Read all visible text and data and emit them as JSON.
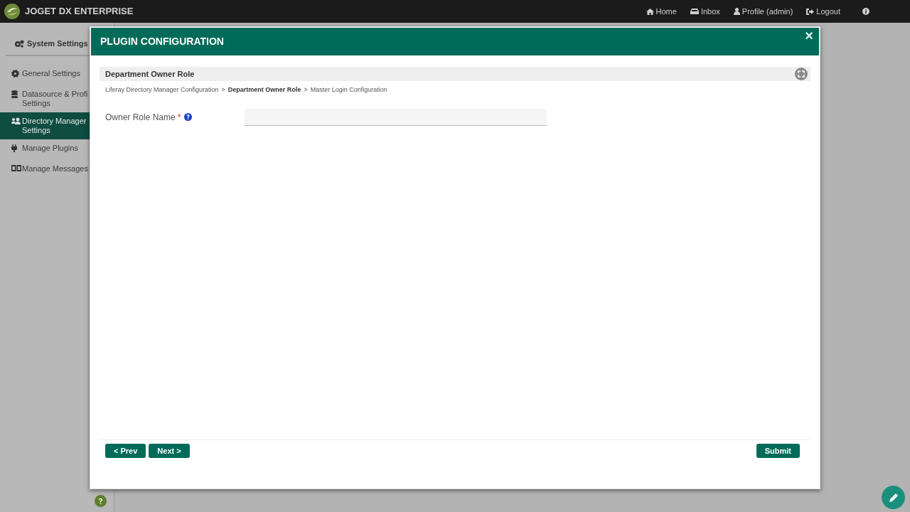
{
  "topbar": {
    "brand": "JOGET DX ENTERPRISE",
    "links": [
      {
        "label": "Home"
      },
      {
        "label": "Inbox"
      },
      {
        "label": "Profile (admin)"
      },
      {
        "label": "Logout"
      }
    ]
  },
  "sidebar": {
    "title": "System Settings",
    "items": [
      {
        "lines": [
          "General Settings"
        ],
        "selected": false
      },
      {
        "lines": [
          "Datasource & Profi",
          "Settings"
        ],
        "selected": false
      },
      {
        "lines": [
          "Directory Manager",
          "Settings"
        ],
        "selected": true
      },
      {
        "lines": [
          "Manage Plugins"
        ],
        "selected": false
      },
      {
        "lines": [
          "Manage Messages"
        ],
        "selected": false
      }
    ]
  },
  "dialog": {
    "title": "PLUGIN CONFIGURATION",
    "close": "×",
    "section_title": "Department Owner Role",
    "breadcrumb": [
      {
        "label": "Liferay Directory Manager Configuration",
        "selected": false
      },
      {
        "label": "Department Owner Role",
        "selected": true
      },
      {
        "label": "Master Login Configuration",
        "selected": false
      }
    ],
    "breadcrumb_separator": ">",
    "fields": [
      {
        "label": "Owner Role Name",
        "required_mark": "*",
        "help": true
      }
    ],
    "buttons_left": [
      "< Prev",
      "Next >"
    ],
    "buttons_right": [
      "Submit"
    ]
  }
}
